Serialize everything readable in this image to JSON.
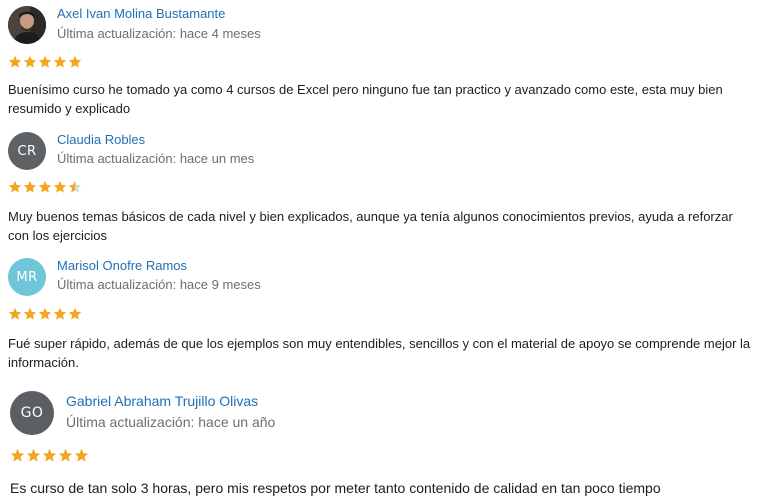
{
  "colors": {
    "name_link": "#1f6fb5",
    "star_filled": "#f4a61d",
    "star_empty": "#d9d9d9",
    "avatar_cr": "#5f6265",
    "avatar_mr": "#6fc6d9",
    "avatar_go": "#5b5e62"
  },
  "reviews": [
    {
      "name": "Axel Ivan Molina Bustamante",
      "updated": "Última actualización: hace 4 meses",
      "avatar_type": "photo",
      "rating": 5,
      "text": "Buenísimo curso he tomado ya como 4 cursos de Excel pero ninguno fue tan practico y avanzado como este, esta muy bien resumido y explicado"
    },
    {
      "name": "Claudia Robles",
      "updated": "Última actualización: hace un mes",
      "avatar_initials": "CR",
      "rating": 4.5,
      "text": "Muy buenos temas básicos de cada nivel y bien explicados, aunque ya tenía algunos conocimientos previos, ayuda a reforzar con los ejercicios"
    },
    {
      "name": "Marisol Onofre Ramos",
      "updated": "Última actualización: hace 9 meses",
      "avatar_initials": "MR",
      "rating": 5,
      "text": "Fué super rápido, además de que los ejemplos son muy entendibles, sencillos y con el material de apoyo se comprende mejor la información."
    },
    {
      "name": "Gabriel Abraham Trujillo Olivas",
      "updated": "Última actualización: hace un año",
      "avatar_initials": "GO",
      "rating": 5,
      "text": "Es curso de tan solo 3 horas, pero mis respetos por meter tanto contenido de calidad en tan poco tiempo"
    }
  ]
}
